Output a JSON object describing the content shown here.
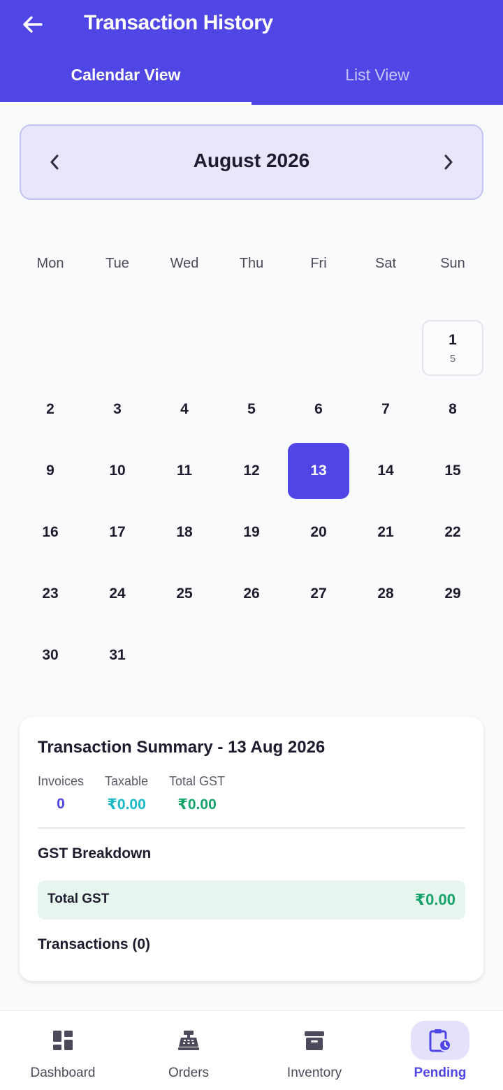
{
  "header": {
    "title": "Transaction History",
    "tabs": [
      {
        "label": "Calendar View",
        "active": true
      },
      {
        "label": "List View",
        "active": false
      }
    ],
    "accent_color": "#4f46e5"
  },
  "calendar": {
    "month_label": "August 2026",
    "weekdays": [
      "Mon",
      "Tue",
      "Wed",
      "Thu",
      "Fri",
      "Sat",
      "Sun"
    ],
    "first_weekday_index": 6,
    "days_in_month": 31,
    "selected_day": 13,
    "transaction_counts": {
      "1": "5"
    }
  },
  "summary": {
    "title": "Transaction Summary - 13 Aug 2026",
    "stats": [
      {
        "label": "Invoices",
        "value": "0",
        "color": "#4f46e5"
      },
      {
        "label": "Taxable",
        "value": "₹0.00",
        "color": "#14b8c8"
      },
      {
        "label": "Total GST",
        "value": "₹0.00",
        "color": "#16a36a"
      }
    ],
    "gst_breakdown_title": "GST Breakdown",
    "gst_total_label": "Total GST",
    "gst_total_value": "₹0.00",
    "transactions_label": "Transactions (0)"
  },
  "bottom_nav": [
    {
      "label": "Dashboard",
      "icon": "dashboard-icon",
      "active": false
    },
    {
      "label": "Orders",
      "icon": "cash-register-icon",
      "active": false
    },
    {
      "label": "Inventory",
      "icon": "archive-box-icon",
      "active": false
    },
    {
      "label": "Pending",
      "icon": "pending-clipboard-icon",
      "active": true
    }
  ]
}
